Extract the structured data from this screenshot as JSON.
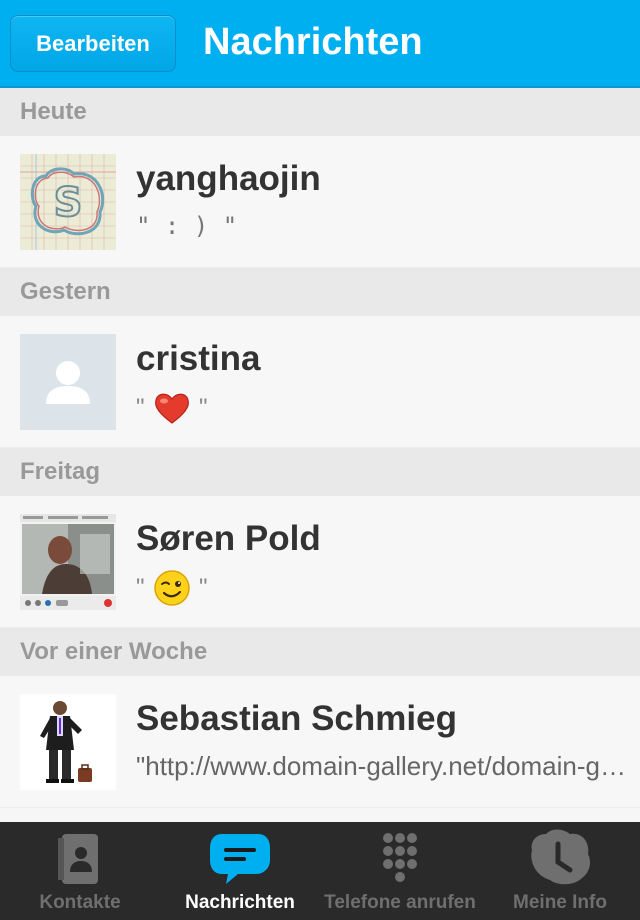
{
  "navbar": {
    "edit_label": "Bearbeiten",
    "title": "Nachrichten"
  },
  "sections": [
    {
      "header": "Heute",
      "items": [
        {
          "name": "yanghaojin",
          "preview": "\" : ) \"",
          "avatar_icon": "skype-logo-sketch-avatar"
        }
      ]
    },
    {
      "header": "Gestern",
      "items": [
        {
          "name": "cristina",
          "preview_open": "\"",
          "preview_close": "\"",
          "emoticon": "heart-emoticon",
          "avatar_icon": "default-user-avatar"
        }
      ]
    },
    {
      "header": "Freitag",
      "items": [
        {
          "name": "Søren Pold",
          "preview_open": "\"",
          "preview_close": "\"",
          "emoticon": "wink-emoticon",
          "avatar_icon": "video-screenshot-avatar"
        }
      ]
    },
    {
      "header": "Vor einer Woche",
      "items": [
        {
          "name": "Sebastian Schmieg",
          "preview": "\"http://www.domain-gallery.net/domain-gallery.net/\"",
          "avatar_icon": "man-with-suitcase-avatar"
        }
      ]
    }
  ],
  "tabbar": {
    "tabs": [
      {
        "label": "Kontakte",
        "icon": "contacts-book-icon",
        "active": false
      },
      {
        "label": "Nachrichten",
        "icon": "chat-bubble-icon",
        "active": true
      },
      {
        "label": "Telefone anrufen",
        "icon": "dialpad-icon",
        "active": false
      },
      {
        "label": "Meine Info",
        "icon": "skype-clock-icon",
        "active": false
      }
    ]
  },
  "colors": {
    "brand": "#00aff0",
    "tabbar": "#2a2a2a",
    "section_bg": "#e9e9e9"
  }
}
